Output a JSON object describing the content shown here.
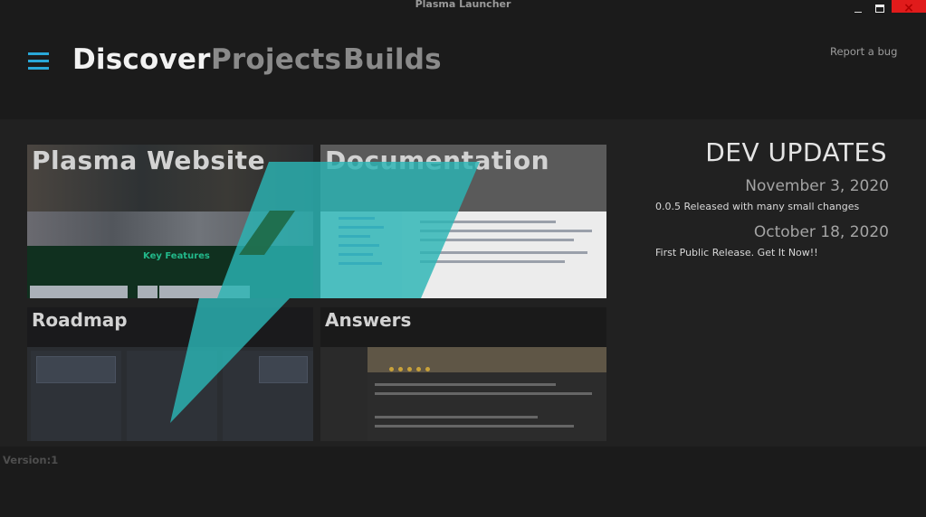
{
  "window": {
    "title": "Plasma Launcher",
    "close_glyph": "×"
  },
  "nav": {
    "tabs": [
      {
        "label": "Discover",
        "active": true
      },
      {
        "label": "Projects",
        "active": false
      },
      {
        "label": "Builds",
        "active": false
      }
    ],
    "report_bug": "Report a bug"
  },
  "tiles": [
    {
      "label": "Plasma Website"
    },
    {
      "label": "Documentation"
    },
    {
      "label": "Roadmap"
    },
    {
      "label": "Answers"
    }
  ],
  "website_preview": {
    "heading": "Key Features"
  },
  "dev_updates": {
    "title": "DEV UPDATES",
    "items": [
      {
        "date": "November 3, 2020",
        "text": "0.0.5 Released with many small changes"
      },
      {
        "date": "October 18, 2020",
        "text": "First Public Release. Get It Now!!"
      }
    ]
  },
  "footer": {
    "version": "Version:1"
  },
  "colors": {
    "accent": "#29a8d8",
    "logo": "#2bb5b5",
    "close": "#e01b1b"
  }
}
